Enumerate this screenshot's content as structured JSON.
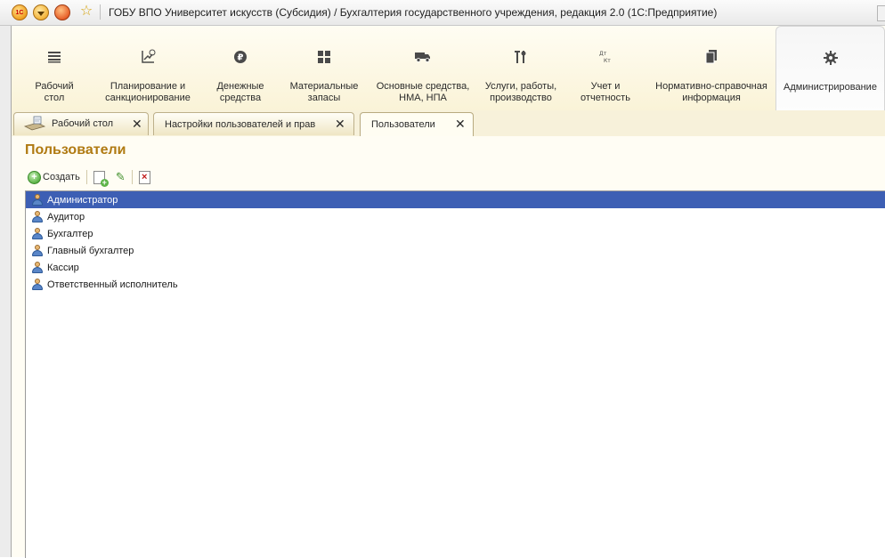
{
  "window": {
    "title": "ГОБУ ВПО Университет искусств (Субсидия) / Бухгалтерия государственного учреждения, редакция 2.0  (1С:Предприятие)"
  },
  "sections": [
    {
      "label": "Рабочий\nстол",
      "icon": "menu-lines-icon",
      "glyph": "≡"
    },
    {
      "label": "Планирование и\nсанкционирование",
      "icon": "planning-chart-icon",
      "glyph": "↗"
    },
    {
      "label": "Денежные\nсредства",
      "icon": "ruble-icon",
      "glyph": "₽"
    },
    {
      "label": "Материальные\nзапасы",
      "icon": "grid-stock-icon",
      "glyph": "▦"
    },
    {
      "label": "Основные средства,\nНМА, НПА",
      "icon": "truck-icon",
      "glyph": "🚚"
    },
    {
      "label": "Услуги, работы,\nпроизводство",
      "icon": "tools-icon",
      "glyph": "⚒"
    },
    {
      "label": "Учет и\nотчетность",
      "icon": "debit-credit-icon",
      "glyph": "Дт/Кт"
    },
    {
      "label": "Нормативно-справочная\nинформация",
      "icon": "documents-icon",
      "glyph": "❐"
    },
    {
      "label": "Администрирование",
      "icon": "gear-icon",
      "glyph": "⚙"
    }
  ],
  "tabs": [
    {
      "label": "Рабочий стол"
    },
    {
      "label": "Настройки пользователей и прав"
    },
    {
      "label": "Пользователи"
    }
  ],
  "page": {
    "title": "Пользователи"
  },
  "toolbar": {
    "create_label": "Создать"
  },
  "users": [
    {
      "name": "Администратор",
      "selected": true
    },
    {
      "name": "Аудитор"
    },
    {
      "name": "Бухгалтер"
    },
    {
      "name": "Главный бухгалтер"
    },
    {
      "name": "Кассир"
    },
    {
      "name": "Ответственный исполнитель"
    }
  ],
  "colors": {
    "accent_title": "#b07a12",
    "selection": "#3d5fb4",
    "panel_bg": "#fffdf4"
  }
}
